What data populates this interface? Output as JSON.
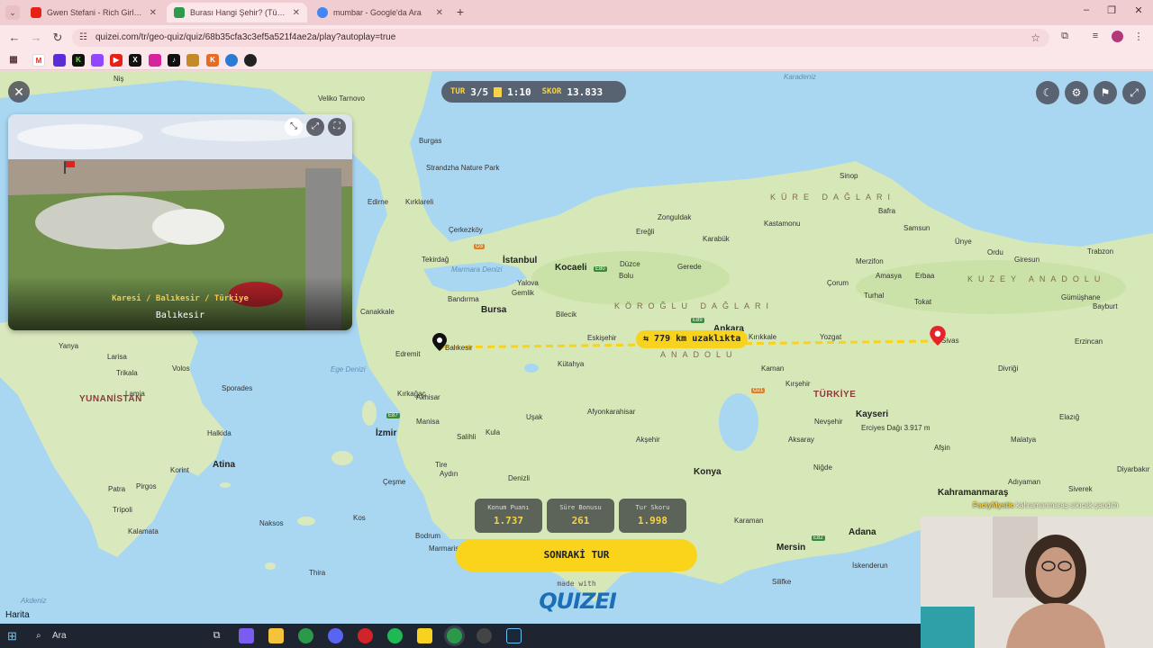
{
  "browser": {
    "tabs": [
      {
        "title": "Gwen Stefani - Rich Girl (Offici...",
        "color": "#e62117"
      },
      {
        "title": "Burası Hangi Şehir? (Türkiye) - ...",
        "color": "#2e9a4a"
      },
      {
        "title": "mumbar - Google'da Ara",
        "color": "#4285f4"
      }
    ],
    "url": "quizei.com/tr/geo-quiz/quiz/68b35cfa3c3ef5a521f4ae2a/play?autoplay=true"
  },
  "hud": {
    "round_key": "TUR",
    "round_value": "3/5",
    "time": "1:10",
    "score_key": "SKOR",
    "score_value": "13.833"
  },
  "photo": {
    "caption_path": "Karesi / Balıkesir / Türkiye",
    "caption_city": "Balıkesir"
  },
  "distance_label": "779 km uzaklıkta",
  "scores": [
    {
      "title": "Konum Puanı",
      "value": "1.737"
    },
    {
      "title": "Süre Bonusu",
      "value": "261"
    },
    {
      "title": "Tur Skoru",
      "value": "1.998"
    }
  ],
  "next_button": "SONRAKİ TUR",
  "made_with": "made with",
  "logo": "QUIZEI",
  "attribution": "Harita",
  "stream_overlay": {
    "user": "FactyMystic",
    "text": "kahramanmaraş sıkıcak şandıth"
  },
  "taskbar": {
    "search_placeholder": "Ara"
  },
  "map": {
    "labels": [
      {
        "t": "Niş",
        "c": "mlabel"
      },
      {
        "t": "Veliko Tarnovo",
        "c": "mlabel"
      },
      {
        "t": "Burgas",
        "c": "mlabel"
      },
      {
        "t": "Strandzha Nature Park",
        "c": "mlabel"
      },
      {
        "t": "Edirne",
        "c": "mlabel"
      },
      {
        "t": "Kırklareli",
        "c": "mlabel"
      },
      {
        "t": "Çerkezköy",
        "c": "mlabel"
      },
      {
        "t": "Tekirdağ",
        "c": "mlabel"
      },
      {
        "t": "İstanbul",
        "c": "mlabel big"
      },
      {
        "t": "Kocaeli",
        "c": "mlabel big"
      },
      {
        "t": "Zonguldak",
        "c": "mlabel"
      },
      {
        "t": "Kastamonu",
        "c": "mlabel"
      },
      {
        "t": "Sinop",
        "c": "mlabel"
      },
      {
        "t": "Samsun",
        "c": "mlabel"
      },
      {
        "t": "Bafra",
        "c": "mlabel"
      },
      {
        "t": "Ünye",
        "c": "mlabel"
      },
      {
        "t": "Ordu",
        "c": "mlabel"
      },
      {
        "t": "Giresun",
        "c": "mlabel"
      },
      {
        "t": "Trabzon",
        "c": "mlabel"
      },
      {
        "t": "Düzce",
        "c": "mlabel"
      },
      {
        "t": "Bolu",
        "c": "mlabel"
      },
      {
        "t": "Gerede",
        "c": "mlabel"
      },
      {
        "t": "Karabük",
        "c": "mlabel"
      },
      {
        "t": "Ereğli",
        "c": "mlabel"
      },
      {
        "t": "Merzifon",
        "c": "mlabel"
      },
      {
        "t": "Amasya",
        "c": "mlabel"
      },
      {
        "t": "Erbaa",
        "c": "mlabel"
      },
      {
        "t": "Çorum",
        "c": "mlabel"
      },
      {
        "t": "Tokat",
        "c": "mlabel"
      },
      {
        "t": "Turhal",
        "c": "mlabel"
      },
      {
        "t": "Gümüşhane",
        "c": "mlabel"
      },
      {
        "t": "Bayburt",
        "c": "mlabel"
      },
      {
        "t": "Erzincan",
        "c": "mlabel"
      },
      {
        "t": "Sivas",
        "c": "mlabel"
      },
      {
        "t": "Divriği",
        "c": "mlabel"
      },
      {
        "t": "Bursa",
        "c": "mlabel big"
      },
      {
        "t": "Gemlik",
        "c": "mlabel"
      },
      {
        "t": "Yalova",
        "c": "mlabel"
      },
      {
        "t": "Bandırma",
        "c": "mlabel"
      },
      {
        "t": "Bilecik",
        "c": "mlabel"
      },
      {
        "t": "Eskişehir",
        "c": "mlabel"
      },
      {
        "t": "Kütahya",
        "c": "mlabel"
      },
      {
        "t": "Ankara",
        "c": "mlabel big"
      },
      {
        "t": "Kırıkkale",
        "c": "mlabel"
      },
      {
        "t": "Yozgat",
        "c": "mlabel"
      },
      {
        "t": "Kaman",
        "c": "mlabel"
      },
      {
        "t": "Kırşehir",
        "c": "mlabel"
      },
      {
        "t": "Kayseri",
        "c": "mlabel big"
      },
      {
        "t": "Erciyes Dağı 3.917 m",
        "c": "mlabel"
      },
      {
        "t": "Malatya",
        "c": "mlabel"
      },
      {
        "t": "Elazığ",
        "c": "mlabel"
      },
      {
        "t": "Diyarbakır",
        "c": "mlabel"
      },
      {
        "t": "Adıyaman",
        "c": "mlabel"
      },
      {
        "t": "Siverek",
        "c": "mlabel"
      },
      {
        "t": "Afşin",
        "c": "mlabel"
      },
      {
        "t": "Kahramanmaraş",
        "c": "mlabel big"
      },
      {
        "t": "Canakkale",
        "c": "mlabel"
      },
      {
        "t": "Edremit",
        "c": "mlabel"
      },
      {
        "t": "Balıkesir",
        "c": "mlabel"
      },
      {
        "t": "Kırkağaç",
        "c": "mlabel"
      },
      {
        "t": "Akhisar",
        "c": "mlabel"
      },
      {
        "t": "Manisa",
        "c": "mlabel"
      },
      {
        "t": "İzmir",
        "c": "mlabel big"
      },
      {
        "t": "Salihli",
        "c": "mlabel"
      },
      {
        "t": "Uşak",
        "c": "mlabel"
      },
      {
        "t": "Afyonkarahisar",
        "c": "mlabel"
      },
      {
        "t": "Akşehir",
        "c": "mlabel"
      },
      {
        "t": "Kula",
        "c": "mlabel"
      },
      {
        "t": "Tire",
        "c": "mlabel"
      },
      {
        "t": "Aydın",
        "c": "mlabel"
      },
      {
        "t": "Denizli",
        "c": "mlabel"
      },
      {
        "t": "Konya",
        "c": "mlabel big"
      },
      {
        "t": "Niğde",
        "c": "mlabel"
      },
      {
        "t": "Aksaray",
        "c": "mlabel"
      },
      {
        "t": "Nevşehir",
        "c": "mlabel"
      },
      {
        "t": "Karaman",
        "c": "mlabel"
      },
      {
        "t": "Mersin",
        "c": "mlabel big"
      },
      {
        "t": "Adana",
        "c": "mlabel big"
      },
      {
        "t": "Silifke",
        "c": "mlabel"
      },
      {
        "t": "İskenderun",
        "c": "mlabel"
      },
      {
        "t": "Bodrum",
        "c": "mlabel"
      },
      {
        "t": "Marmaris",
        "c": "mlabel"
      },
      {
        "t": "Çeşme",
        "c": "mlabel"
      },
      {
        "t": "Yanya",
        "c": "mlabel"
      },
      {
        "t": "Larisa",
        "c": "mlabel"
      },
      {
        "t": "Volos",
        "c": "mlabel"
      },
      {
        "t": "Trikala",
        "c": "mlabel"
      },
      {
        "t": "Lamia",
        "c": "mlabel"
      },
      {
        "t": "Halkida",
        "c": "mlabel"
      },
      {
        "t": "Atina",
        "c": "mlabel big"
      },
      {
        "t": "Korint",
        "c": "mlabel"
      },
      {
        "t": "Patra",
        "c": "mlabel"
      },
      {
        "t": "Pirgos",
        "c": "mlabel"
      },
      {
        "t": "Trípoli",
        "c": "mlabel"
      },
      {
        "t": "Kalamata",
        "c": "mlabel"
      },
      {
        "t": "Naksos",
        "c": "mlabel"
      },
      {
        "t": "Thira",
        "c": "mlabel"
      },
      {
        "t": "Sporades",
        "c": "mlabel"
      },
      {
        "t": "Kos",
        "c": "mlabel"
      },
      {
        "t": "TÜRKİYE",
        "c": "mlabel country"
      },
      {
        "t": "YUNANİSTAN",
        "c": "mlabel country"
      },
      {
        "t": "Karadeniz",
        "c": "mlabel sea"
      },
      {
        "t": "Marmara Denizi",
        "c": "mlabel sea"
      },
      {
        "t": "Ege Denizi",
        "c": "mlabel sea"
      },
      {
        "t": "Akdeniz",
        "c": "mlabel sea"
      },
      {
        "t": "KÖROĞLU DAĞLARI",
        "c": "mlabel region"
      },
      {
        "t": "ANADOLU",
        "c": "mlabel region"
      },
      {
        "t": "KÜRE DAĞLARI",
        "c": "mlabel region"
      },
      {
        "t": "KUZEY ANADOLU",
        "c": "mlabel region"
      }
    ]
  }
}
